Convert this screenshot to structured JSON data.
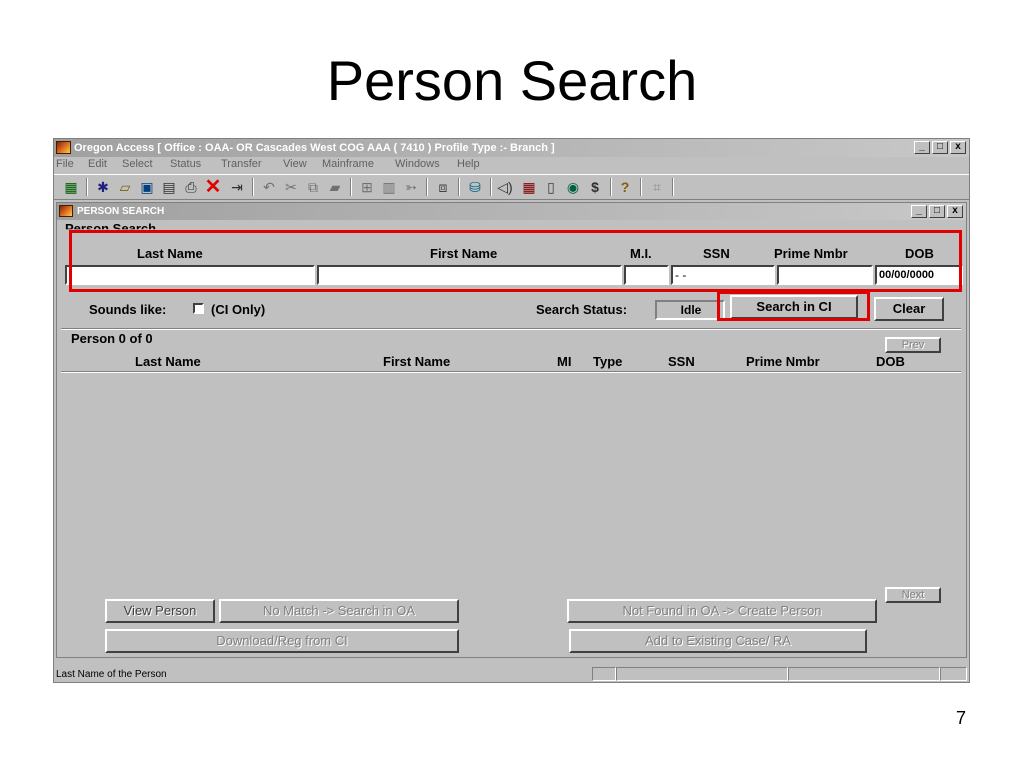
{
  "slide": {
    "title": "Person Search",
    "page_number": "7"
  },
  "window": {
    "title": "Oregon Access [ Office : OAA- OR Cascades West COG AAA ( 7410 ) Profile Type :- Branch ]",
    "controls": {
      "minimize": "_",
      "maximize": "□",
      "close": "x"
    }
  },
  "menu": [
    "File",
    "Edit",
    "Select",
    "Status",
    "Transfer",
    "View",
    "Mainframe",
    "Windows",
    "Help"
  ],
  "toolbar_icons": [
    "grid-icon",
    "runner-icon",
    "open-folder-icon",
    "save-icon",
    "disk-icon",
    "print-icon",
    "delete-icon",
    "exit-icon",
    "undo-icon",
    "cut-icon",
    "copy-icon",
    "paste-icon",
    "insert-row-icon",
    "trash-icon",
    "eraser-icon",
    "tile-icon",
    "network-icon",
    "sound-icon",
    "calendar-icon",
    "book-icon",
    "globe-icon",
    "dollar-icon",
    "help-icon",
    "grid2-icon"
  ],
  "inner_window": {
    "title": "PERSON SEARCH",
    "controls": {
      "minimize": "_",
      "maximize": "□",
      "close": "x"
    }
  },
  "search": {
    "group_label": "Person Search",
    "columns": {
      "last_name": "Last Name",
      "first_name": "First Name",
      "mi": "M.I.",
      "ssn": "SSN",
      "prime_nmbr": "Prime Nmbr",
      "dob": "DOB"
    },
    "values": {
      "last_name": "",
      "first_name": "",
      "mi": "",
      "ssn": " -  - ",
      "prime_nmbr": "",
      "dob": "00/00/0000"
    },
    "sounds_like_label": "Sounds like:",
    "sounds_like_note": "(CI Only)",
    "sounds_like_checked": false,
    "status_label": "Search Status:",
    "status_value": "Idle",
    "search_button": "Search in CI",
    "clear_button": "Clear"
  },
  "results": {
    "group_label": "Person 0 of 0",
    "prev_button": "Prev",
    "next_button": "Next",
    "columns": {
      "last_name": "Last Name",
      "first_name": "First Name",
      "mi": "MI",
      "type": "Type",
      "ssn": "SSN",
      "prime_nmbr": "Prime Nmbr",
      "dob": "DOB"
    }
  },
  "actions": {
    "view_person": "View Person",
    "no_match": "No Match -> Search in OA",
    "not_found": "Not Found in OA -> Create Person",
    "download": "Download/Reg from CI",
    "add_existing": "Add to Existing Case/ RA"
  },
  "status_bar": {
    "text": "Last Name of the Person"
  },
  "highlight_color": "#e00000"
}
